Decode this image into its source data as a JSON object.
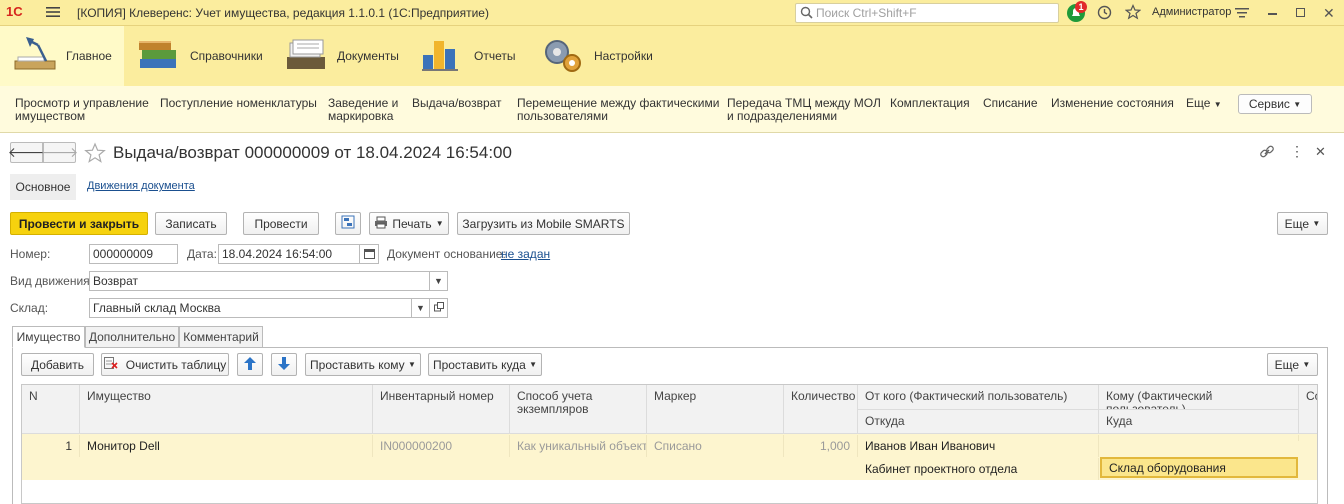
{
  "titlebar": {
    "logo": "1С",
    "window_title": "[КОПИЯ] Клеверенс: Учет имущества, редакция 1.1.0.1  (1С:Предприятие)",
    "search_placeholder": "Поиск Ctrl+Shift+F",
    "notification_count": "1",
    "user": "Администратор"
  },
  "sections": [
    {
      "label": "Главное",
      "icon": "desk-lamp-icon"
    },
    {
      "label": "Справочники",
      "icon": "books-icon"
    },
    {
      "label": "Документы",
      "icon": "documents-icon"
    },
    {
      "label": "Отчеты",
      "icon": "chart-icon"
    },
    {
      "label": "Настройки",
      "icon": "gears-icon"
    }
  ],
  "function_panel": {
    "items": [
      {
        "line1": "Просмотр и управление",
        "line2": "имуществом"
      },
      {
        "line1": "Поступление номенклатуры",
        "line2": ""
      },
      {
        "line1": "Заведение и",
        "line2": "маркировка"
      },
      {
        "line1": "Выдача/возврат",
        "line2": ""
      },
      {
        "line1": "Перемещение между фактическими",
        "line2": "пользователями"
      },
      {
        "line1": "Передача ТМЦ между МОЛ",
        "line2": "и подразделениями"
      },
      {
        "line1": "Комплектация",
        "line2": ""
      },
      {
        "line1": "Списание",
        "line2": ""
      },
      {
        "line1": "Изменение состояния",
        "line2": ""
      }
    ],
    "more_label": "Еще",
    "service_label": "Сервис"
  },
  "form": {
    "title": "Выдача/возврат 000000009 от 18.04.2024 16:54:00",
    "tab_main": "Основное",
    "tab_movements": "Движения документа",
    "toolbar": {
      "post_close": "Провести и закрыть",
      "save": "Записать",
      "post": "Провести",
      "print": "Печать",
      "load_mobile": "Загрузить из Mobile SMARTS",
      "more": "Еще"
    },
    "number_label": "Номер:",
    "number_value": "000000009",
    "date_label": "Дата:",
    "date_value": "18.04.2024 16:54:00",
    "basis_label": "Документ основание:",
    "basis_value": "не задан",
    "movement_type_label": "Вид движения:",
    "movement_type_value": "Возврат",
    "warehouse_label": "Склад:",
    "warehouse_value": "Главный склад Москва",
    "inner_tabs": [
      "Имущество",
      "Дополнительно",
      "Комментарий"
    ],
    "table_toolbar": {
      "add": "Добавить",
      "clear": "Очистить таблицу",
      "set_to_whom": "Проставить кому",
      "set_where": "Проставить куда",
      "more": "Еще"
    },
    "columns": {
      "n": "N",
      "property": "Имущество",
      "inventory_number": "Инвентарный номер",
      "accounting_method": "Способ учета экземпляров",
      "marker": "Маркер",
      "quantity": "Количество",
      "from_user": "От кого (Фактический пользователь)",
      "from_place": "Откуда",
      "to_user": "Кому (Фактический пользователь)",
      "to_place": "Куда",
      "extra": "Со"
    },
    "rows": [
      {
        "n": "1",
        "property": "Монитор Dell",
        "inventory_number": "IN000000200",
        "accounting_method": "Как уникальный объект",
        "marker": "Списано",
        "quantity": "1,000",
        "from_user": "Иванов Иван Иванович",
        "from_place": "Кабинет проектного отдела",
        "to_user": "",
        "to_place": "Склад оборудования"
      }
    ]
  }
}
